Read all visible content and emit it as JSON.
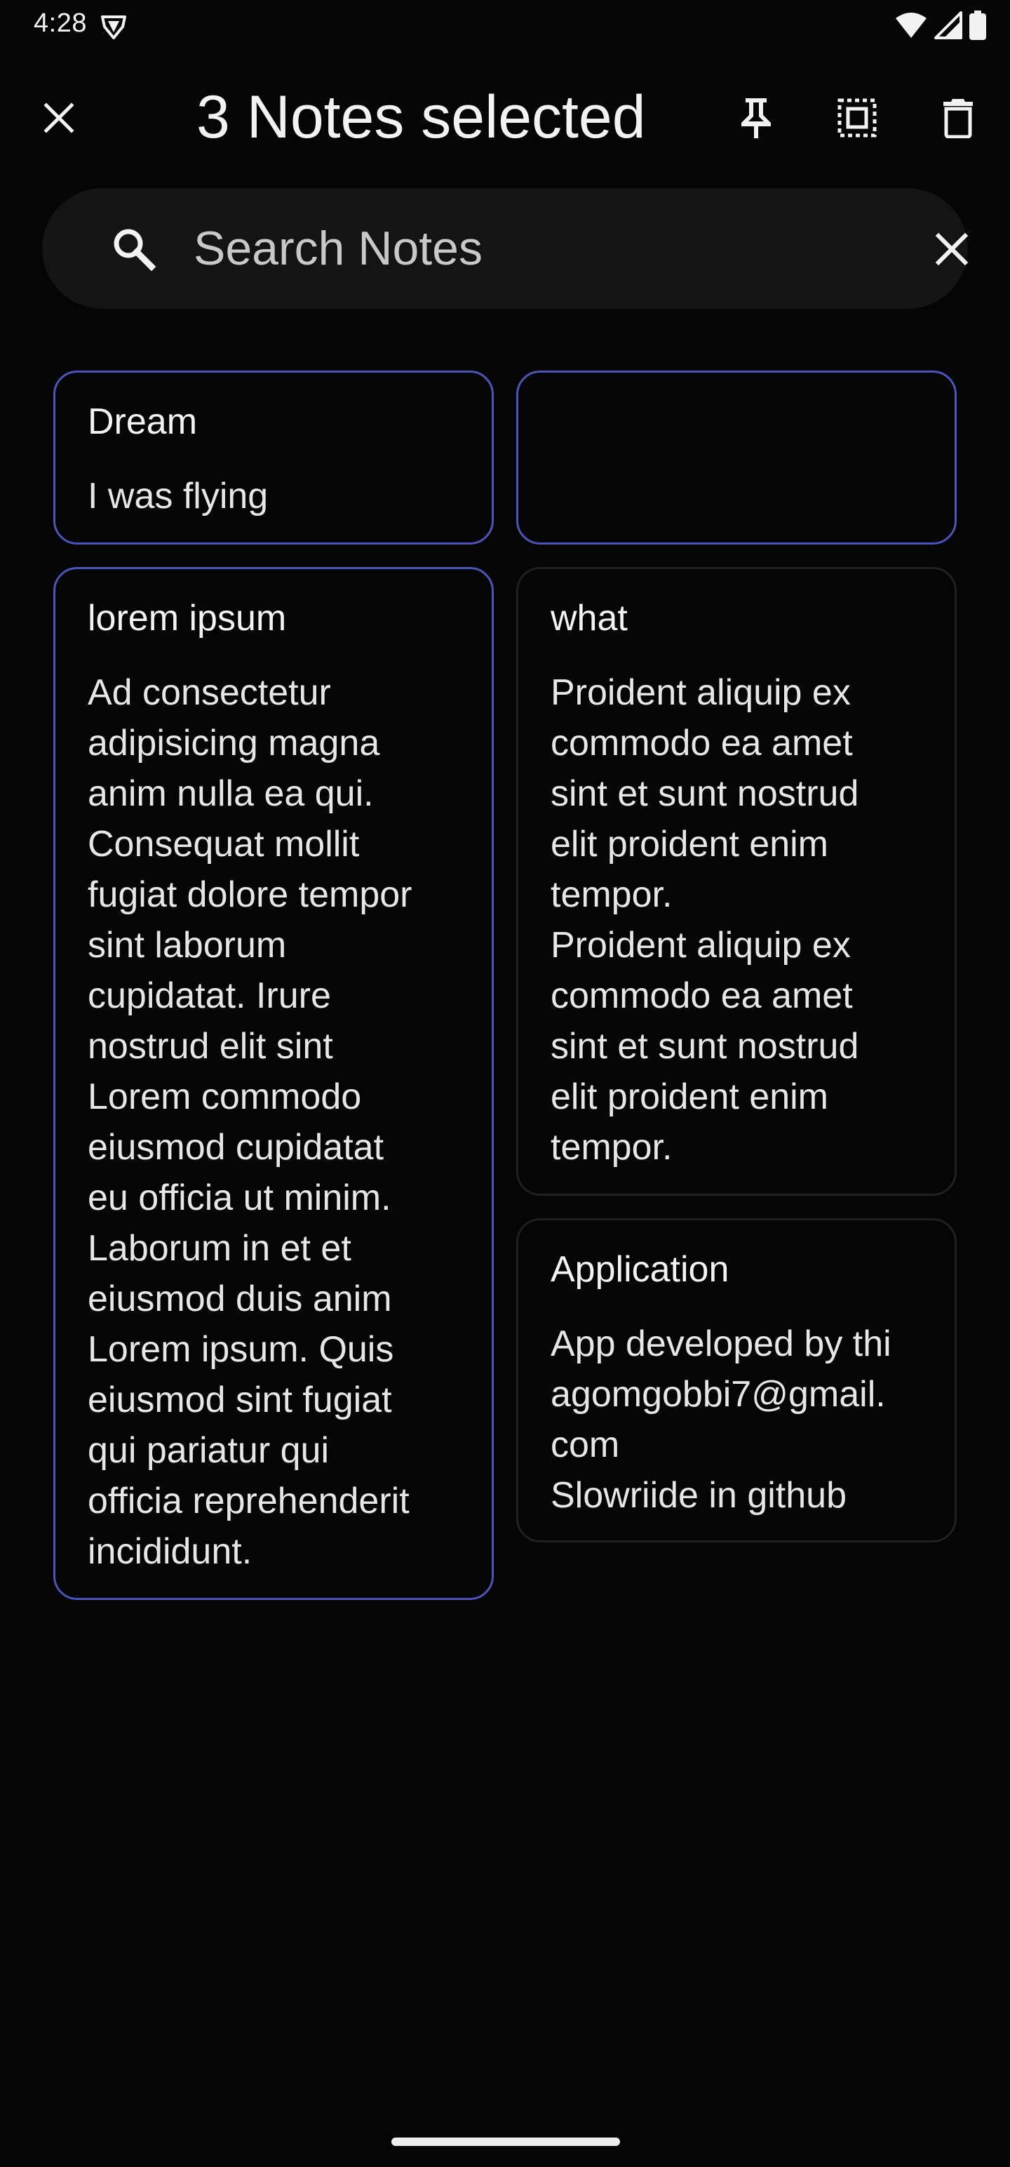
{
  "status_bar": {
    "time": "4:28",
    "icons": [
      "shield-icon",
      "wifi-icon",
      "cell-signal-icon",
      "battery-icon"
    ]
  },
  "header": {
    "title": "3 Notes selected",
    "icons": [
      "close-icon",
      "pin-icon",
      "select-all-icon",
      "delete-icon"
    ]
  },
  "search": {
    "placeholder": "Search Notes",
    "value": ""
  },
  "notes": [
    {
      "title": "Dream",
      "body": "I was flying",
      "selected": true
    },
    {
      "title": "",
      "body": "",
      "selected": true
    },
    {
      "title": "lorem ipsum",
      "body": "Ad consectetur\nadipisicing magna\nanim nulla ea qui.\nConsequat mollit\nfugiat dolore tempor\nsint laborum\ncupidatat. Irure\nnostrud elit sint\nLorem commodo\neiusmod cupidatat\neu officia ut minim.\nLaborum in et et\neiusmod duis anim\nLorem ipsum. Quis\neiusmod sint fugiat\nqui pariatur qui\nofficia reprehenderit\nincididunt.",
      "selected": true
    },
    {
      "title": "what",
      "body": "Proident aliquip ex\ncommodo ea amet\nsint et sunt nostrud\nelit proident enim\ntempor.\nProident aliquip ex\ncommodo ea amet\nsint et sunt nostrud\nelit proident enim\ntempor.",
      "selected": false
    },
    {
      "title": "Application",
      "body": "App developed by thi\nagomgobbi7@gmail.\ncom\nSlowriide in github",
      "selected": false
    }
  ],
  "colors": {
    "background": "#050505",
    "selected_border": "#4B55B8",
    "card_border": "#202020",
    "search_background": "#141414"
  }
}
